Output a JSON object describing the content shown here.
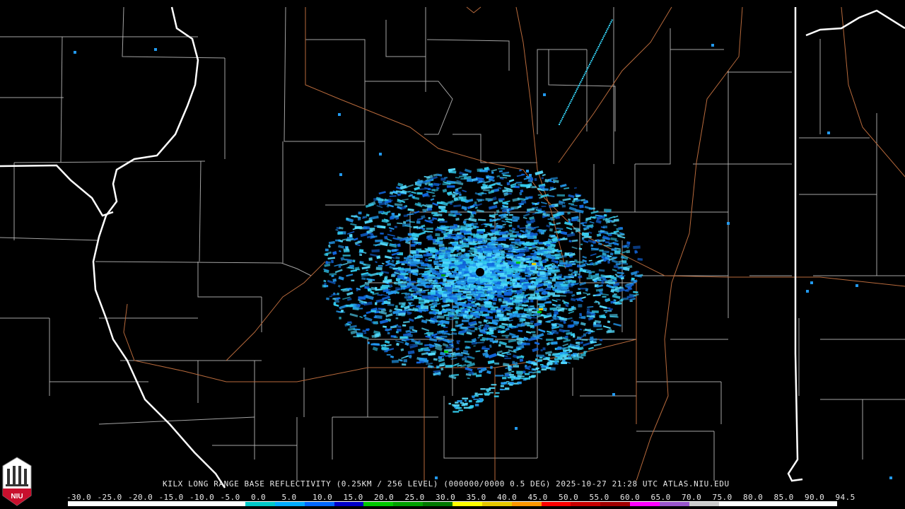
{
  "product": {
    "station": "KILX",
    "caption": "KILX LONG RANGE BASE REFLECTIVITY (0.25KM / 256 LEVEL) (000000/0000 0.5 DEG) 2025-10-27 21:28 UTC  ATLAS.NIU.EDU"
  },
  "logo": {
    "text": "NIU",
    "color": "#c8102e"
  },
  "colorscale": {
    "labels": [
      "-30.0",
      "-25.0",
      "-20.0",
      "-15.0",
      "-10.0",
      "-5.0",
      "0.0",
      "5.0",
      "10.0",
      "15.0",
      "20.0",
      "25.0",
      "30.0",
      "35.0",
      "40.0",
      "45.0",
      "50.0",
      "55.0",
      "60.0",
      "65.0",
      "70.0",
      "75.0",
      "80.0",
      "85.0",
      "90.0",
      "94.5"
    ],
    "colors": [
      "#ffffff",
      "#ffffff",
      "#ffffff",
      "#ffffff",
      "#ffffff",
      "#ffffff",
      "#00c8c8",
      "#00aaff",
      "#0066ff",
      "#0000c8",
      "#00c800",
      "#00a000",
      "#007800",
      "#ffff00",
      "#e6c800",
      "#ff9600",
      "#ff0000",
      "#c80000",
      "#a00000",
      "#ff00ff",
      "#9955cc",
      "#cccccc",
      "#ffffff",
      "#ffffff",
      "#ffffff",
      "#ffffff"
    ]
  },
  "map_layers": {
    "state_border_color": "#ffffff",
    "county_border_color": "#c0c0c0",
    "highway_color": "#b86a3c",
    "echo_colors": [
      "#33ccee",
      "#2299ee",
      "#55ddff",
      "#1166dd"
    ]
  }
}
